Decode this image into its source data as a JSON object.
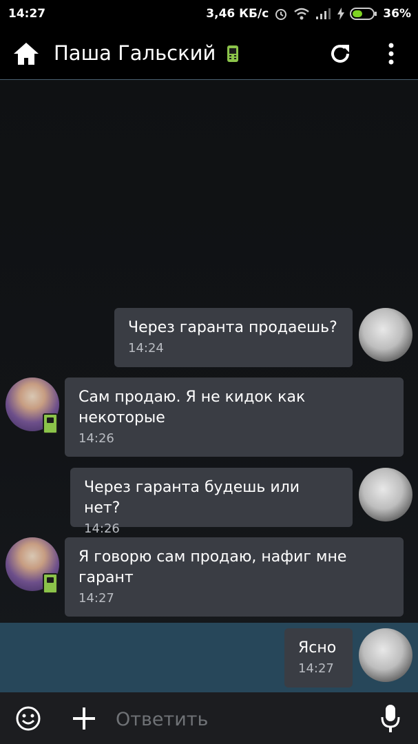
{
  "status_bar": {
    "time": "14:27",
    "network_speed": "3,46 КБ/с",
    "battery": "36%",
    "icons": [
      "alarm-icon",
      "wifi-icon",
      "signal-icon",
      "charging-icon",
      "battery-icon"
    ]
  },
  "header": {
    "title": "Паша Гальский",
    "icons": [
      "home-icon",
      "mobile-status-icon",
      "refresh-icon",
      "more-icon"
    ]
  },
  "messages": [
    {
      "side": "right",
      "text": "Через гаранта продаешь?",
      "time": "14:24"
    },
    {
      "side": "left",
      "text": "Сам продаю. Я не кидок как некоторые",
      "time": "14:26"
    },
    {
      "side": "right",
      "text": "Через гаранта будешь или нет?",
      "time": "14:26"
    },
    {
      "side": "left",
      "text": "Я говорю сам продаю, нафиг мне гарант",
      "time": "14:27"
    },
    {
      "side": "right",
      "text": "Ясно",
      "time": "14:27",
      "highlighted": true
    }
  ],
  "input": {
    "placeholder": "Ответить",
    "value": ""
  },
  "colors": {
    "bubble": "#3a3d44",
    "highlight": "#27475a",
    "badge": "#8bc34a"
  }
}
